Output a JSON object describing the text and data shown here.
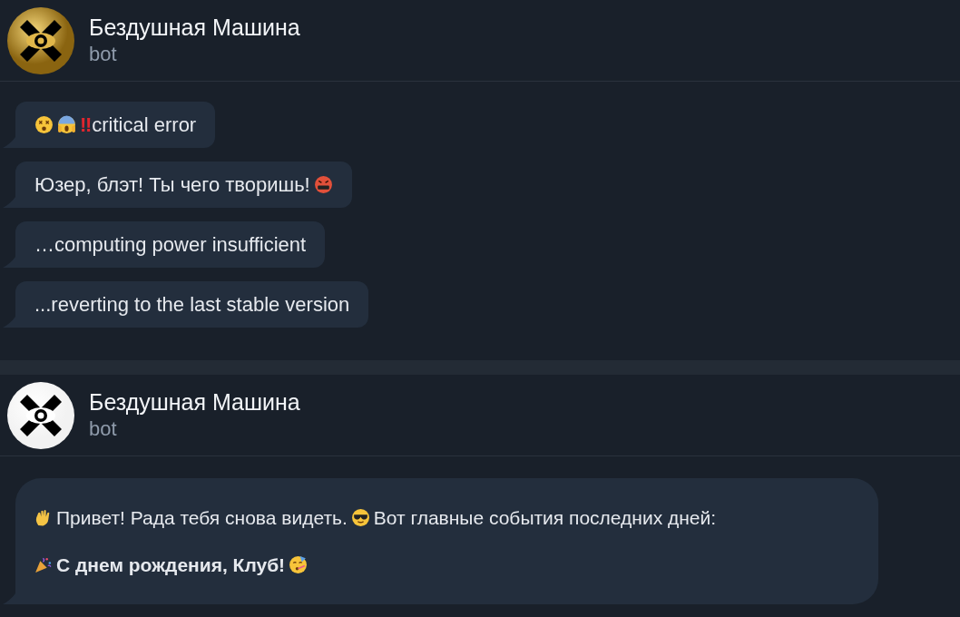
{
  "chats": [
    {
      "header": {
        "name": "Бездушная Машина",
        "subtitle": "bot",
        "avatar": {
          "kind": "gold"
        }
      },
      "kind": "stack",
      "messages": [
        {
          "lines": [
            {
              "bold": false,
              "segments": [
                {
                  "kind": "dizzy"
                },
                {
                  "kind": "scream"
                },
                {
                  "kind": "alert",
                  "text": "‼"
                },
                {
                  "kind": "text",
                  "text": "critical error"
                }
              ]
            }
          ]
        },
        {
          "lines": [
            {
              "bold": false,
              "segments": [
                {
                  "kind": "text",
                  "text": "Юзер, блэт! Ты чего творишь!"
                },
                {
                  "kind": "cursing"
                }
              ]
            }
          ]
        },
        {
          "lines": [
            {
              "bold": false,
              "segments": [
                {
                  "kind": "text",
                  "text": "…computing power insufficient"
                }
              ]
            }
          ]
        },
        {
          "lines": [
            {
              "bold": false,
              "segments": [
                {
                  "kind": "text",
                  "text": "...reverting to the last stable version"
                }
              ]
            }
          ]
        }
      ]
    },
    {
      "header": {
        "name": "Бездушная Машина",
        "subtitle": "bot",
        "avatar": {
          "kind": "plain"
        }
      },
      "kind": "card",
      "messages": [
        {
          "lines": [
            {
              "bold": false,
              "segments": [
                {
                  "kind": "wave"
                },
                {
                  "kind": "text",
                  "text": "Привет! Рада тебя снова видеть."
                },
                {
                  "kind": "sunglasses"
                },
                {
                  "kind": "text",
                  "text": "Вот главные события последних дней:"
                }
              ]
            },
            {
              "bold": true,
              "segments": [
                {
                  "kind": "popper"
                },
                {
                  "kind": "text",
                  "text": "С днем рождения, Клуб!"
                },
                {
                  "kind": "partying"
                }
              ]
            }
          ]
        }
      ]
    }
  ]
}
